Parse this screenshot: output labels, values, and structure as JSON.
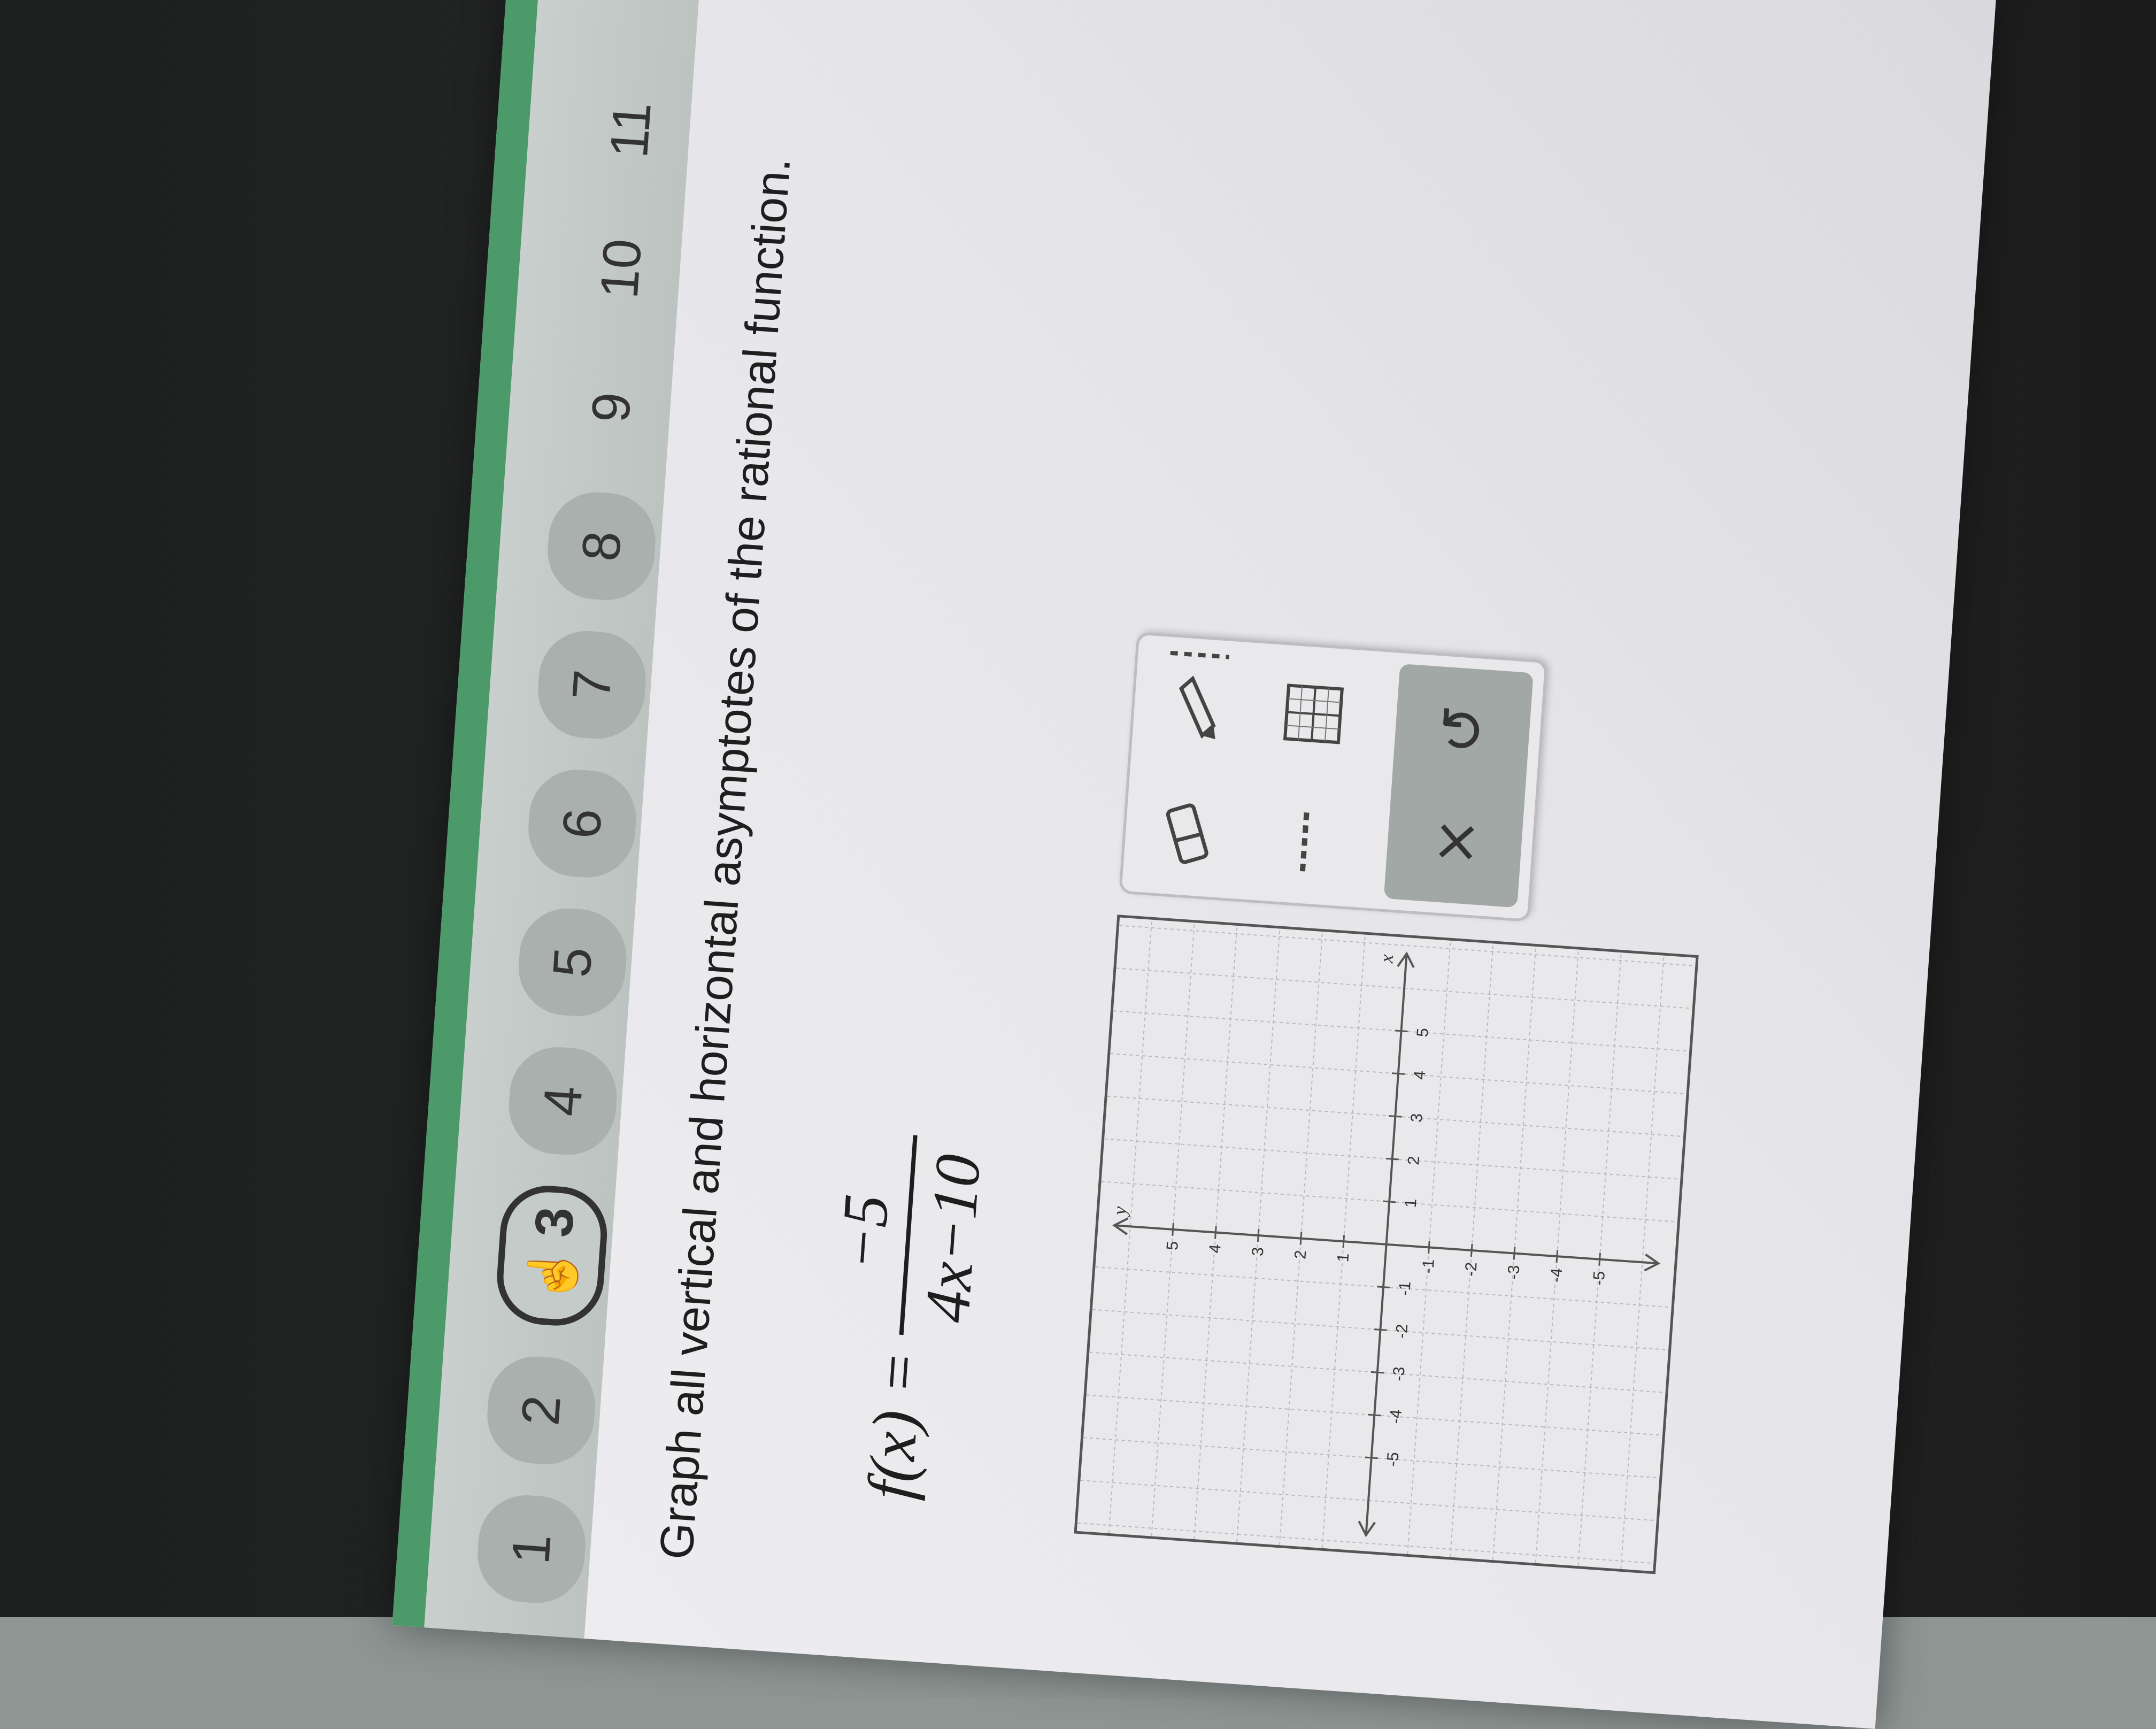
{
  "nav": {
    "questions": [
      "1",
      "2",
      "3",
      "4",
      "5",
      "6",
      "7",
      "8",
      "9",
      "10",
      "11"
    ],
    "current": "3"
  },
  "question": {
    "prompt": "Graph all vertical and horizontal asymptotes of the rational function.",
    "formula": {
      "lhs": "f(x) =",
      "numerator": "−5",
      "denominator": "4x−10"
    }
  },
  "graph": {
    "x_axis_label": "x",
    "y_axis_label": "y",
    "x_ticks": [
      "-5",
      "-4",
      "-3",
      "-2",
      "-1",
      "1",
      "2",
      "3",
      "4",
      "5"
    ],
    "y_ticks": [
      "5",
      "4",
      "3",
      "2",
      "1",
      "-1",
      "-2",
      "-3",
      "-4",
      "-5"
    ]
  },
  "toolbar": {
    "tools": [
      "eraser-icon",
      "pencil-icon",
      "asymptote-dashed-line-icon",
      "grid-tool-icon",
      "dashed-line-icon"
    ],
    "clear_label": "×",
    "undo_label": "↺"
  }
}
